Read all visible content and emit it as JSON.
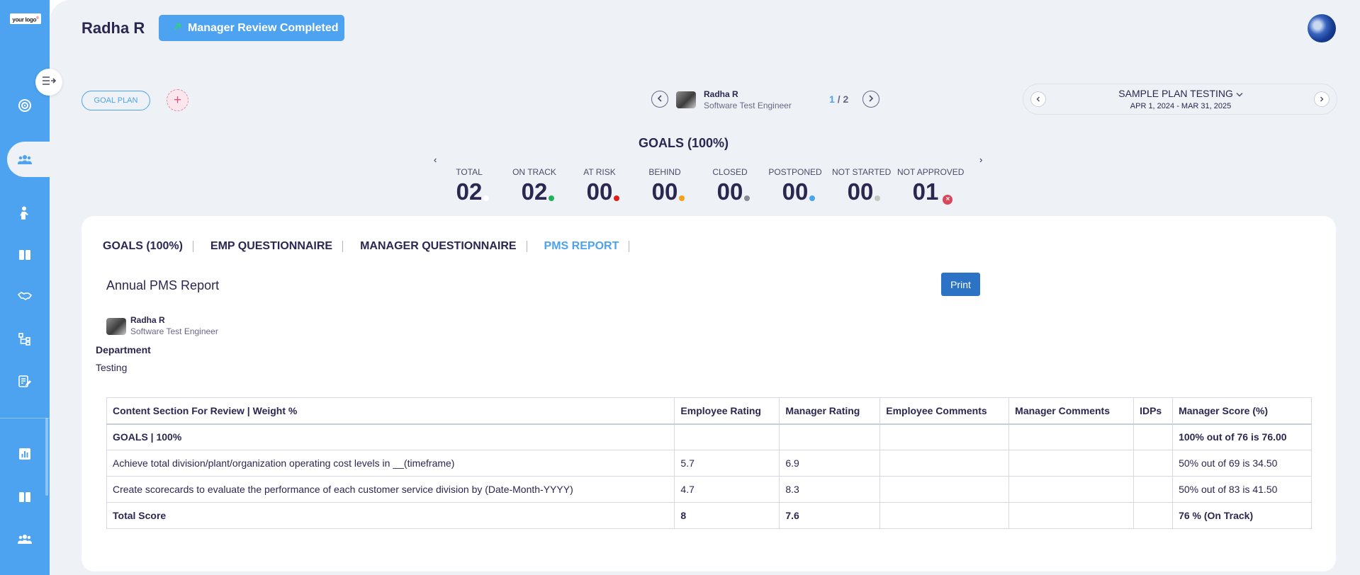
{
  "sidebar": {
    "logo_text": "your logo",
    "logo_mark": "®",
    "icons": [
      "target-icon",
      "team-icon",
      "person-icon",
      "book-icon",
      "handshake-icon",
      "hierarchy-icon",
      "document-edit-icon",
      "bar-chart-icon",
      "book-icon",
      "group-icon"
    ]
  },
  "header": {
    "employee_name": "Radha R",
    "status_label": "Manager Review Completed"
  },
  "toolbar": {
    "goal_plan_label": "GOAL PLAN",
    "add_label": "+"
  },
  "employee_switcher": {
    "name": "Radha R",
    "role": "Software Test Engineer",
    "current": "1",
    "separator": "/",
    "total": "2"
  },
  "plan": {
    "name": "SAMPLE PLAN TESTING",
    "dates": "APR 1, 2024 - MAR 31, 2025"
  },
  "goals_summary": {
    "title": "GOALS (100%)",
    "left_arrow": "‹",
    "right_arrow": "›",
    "stats": [
      {
        "label": "TOTAL",
        "value": "02",
        "color": "#ffffff"
      },
      {
        "label": "ON TRACK",
        "value": "02",
        "color": "#22b25a"
      },
      {
        "label": "AT RISK",
        "value": "00",
        "color": "#e01b1b"
      },
      {
        "label": "BEHIND",
        "value": "00",
        "color": "#f5a11a"
      },
      {
        "label": "CLOSED",
        "value": "00",
        "color": "#8a8a94"
      },
      {
        "label": "POSTPONED",
        "value": "00",
        "color": "#4da3ef"
      },
      {
        "label": "NOT STARTED",
        "value": "00",
        "color": "#c4c4c4"
      },
      {
        "label": "NOT APPROVED",
        "value": "01",
        "color": "#d9475a",
        "badge": "×"
      }
    ]
  },
  "tabs": [
    {
      "label": "GOALS (100%)"
    },
    {
      "label": "EMP QUESTIONNAIRE"
    },
    {
      "label": "MANAGER QUESTIONNAIRE"
    },
    {
      "label": "PMS REPORT",
      "active": true
    }
  ],
  "report": {
    "title": "Annual PMS Report",
    "print_label": "Print",
    "employee": {
      "name": "Radha R",
      "role": "Software Test Engineer"
    },
    "department_label": "Department",
    "department_value": "Testing",
    "table": {
      "headers": [
        "Content Section For Review | Weight %",
        "Employee Rating",
        "Manager Rating",
        "Employee Comments",
        "Manager Comments",
        "IDPs",
        "Manager Score (%)"
      ],
      "rows": [
        {
          "cells": [
            "GOALS | 100%",
            "",
            "",
            "",
            "",
            "",
            "100% out of 76 is 76.00"
          ],
          "bold": true
        },
        {
          "cells": [
            "Achieve total division/plant/organization operating cost levels in __(timeframe)",
            "5.7",
            "6.9",
            "",
            "",
            "",
            "50% out of 69 is 34.50"
          ],
          "bold": false
        },
        {
          "cells": [
            "Create scorecards to evaluate the performance of each customer service division by (Date-Month-YYYY)",
            "4.7",
            "8.3",
            "",
            "",
            "",
            "50% out of 83 is 41.50"
          ],
          "bold": false
        },
        {
          "cells": [
            "Total Score",
            "8",
            "7.6",
            "",
            "",
            "",
            "76  % (On Track)"
          ],
          "bold": true
        }
      ]
    }
  }
}
